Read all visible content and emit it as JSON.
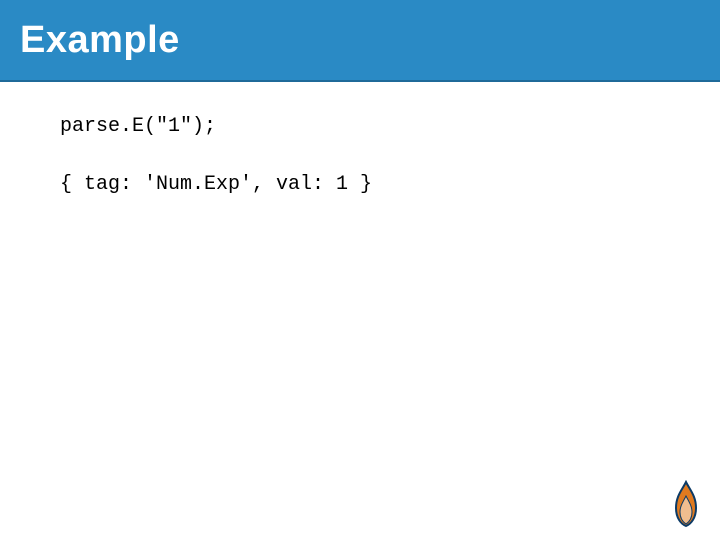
{
  "header": {
    "title": "Example"
  },
  "code": {
    "line1": "parse.E(\"1\");",
    "line2": "{ tag: 'Num.Exp', val: 1 }"
  },
  "colors": {
    "header_bg": "#2a8ac5",
    "header_text": "#ffffff",
    "logo_primary": "#e07a1f",
    "logo_border": "#0b3a66"
  }
}
